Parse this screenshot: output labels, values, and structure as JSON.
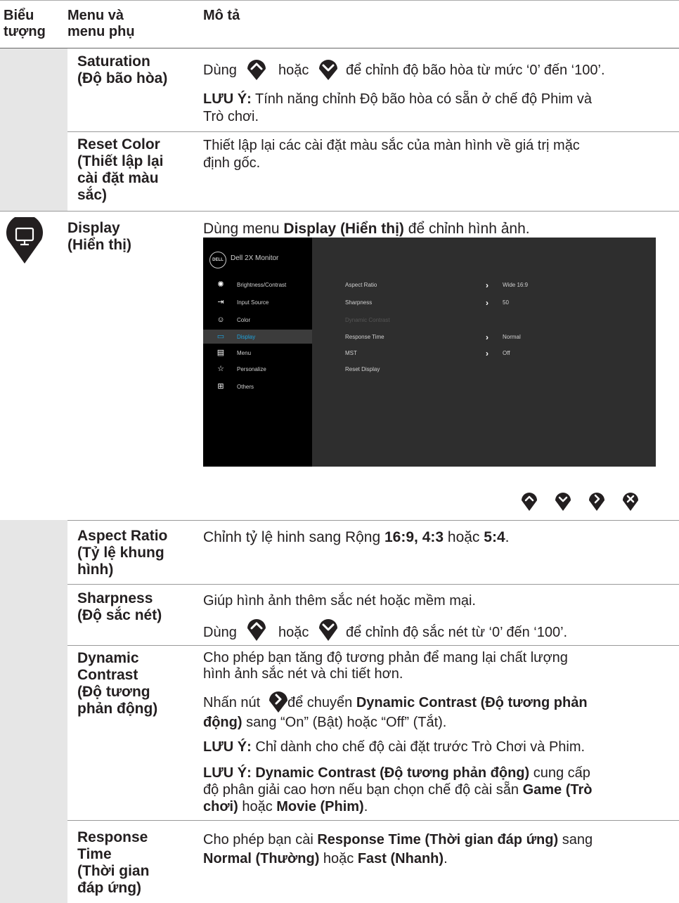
{
  "header": {
    "col1": [
      "Biểu",
      "tượng"
    ],
    "col2": [
      "Menu và",
      "menu phụ"
    ],
    "col3": "Mô tả"
  },
  "rows": {
    "saturation": {
      "label": [
        "Saturation",
        "(Độ bão hòa)"
      ],
      "line1_pre": "Dùng",
      "line1_mid": "hoặc",
      "line1_post": "để chỉnh độ bão hòa từ mức ‘0’ đến ‘100’.",
      "note_bold": "LƯU Ý:",
      "note_text": " Tính năng chỉnh Độ bão hòa có sẵn ở chế độ Phim và",
      "note_text2": "Trò chơi."
    },
    "reset_color": {
      "label": [
        "Reset Color",
        "(Thiết lập lại",
        "cài đặt màu",
        "sắc)"
      ],
      "desc": [
        "Thiết lập lại các cài đặt màu sắc của màn hình về giá trị mặc",
        "định gốc."
      ]
    },
    "display": {
      "label": [
        "Display",
        "(Hiển thị)"
      ],
      "desc_pre": "Dùng menu ",
      "desc_bold": "Display (Hiển thị)",
      "desc_post": " để chỉnh hình ảnh."
    },
    "aspect_ratio": {
      "label": [
        "Aspect Ratio",
        "(Tỷ lệ khung",
        "hình)"
      ],
      "desc_pre": "Chỉnh tỷ lệ hinh sang Rộng ",
      "desc_b1": "16:9, 4:3",
      "desc_mid": " hoặc ",
      "desc_b2": "5:4",
      "desc_post": "."
    },
    "sharpness": {
      "label": [
        "Sharpness",
        "(Độ sắc nét)"
      ],
      "desc1": "Giúp hình ảnh thêm sắc nét hoặc mềm mại.",
      "line2_pre": "Dùng",
      "line2_mid": "hoặc",
      "line2_post": "để chỉnh độ sắc nét từ ‘0’ đến ‘100’."
    },
    "dynamic_contrast": {
      "label": [
        "Dynamic",
        "Contrast",
        "(Độ tương",
        "phản động)"
      ],
      "desc1": [
        "Cho phép bạn tăng độ tương phản để mang lại chất lượng",
        "hình ảnh sắc nét và chi tiết hơn."
      ],
      "p2_pre": "Nhấn nút",
      "p2_mid": " để chuyển ",
      "p2_bold1": "Dynamic Contrast (Độ tương phản",
      "p2_bold2": "động)",
      "p2_post": " sang “On” (Bật) hoặc “Off” (Tắt).",
      "note1_bold": "LƯU Ý:",
      "note1_text": " Chỉ dành cho chế độ cài đặt trước Trò Chơi và Phim.",
      "note2_bold": "LƯU Ý: Dynamic Contrast (Độ tương phản động)",
      "note2_text": " cung cấp",
      "note2_line2_pre": "độ phân giải cao hơn nếu bạn chọn chế độ cài sẵn ",
      "note2_line2_bold": "Game (Trò",
      "note2_line3_bold1": "chơi)",
      "note2_line3_mid": " hoặc ",
      "note2_line3_bold2": "Movie (Phim)",
      "note2_line3_post": "."
    },
    "response_time": {
      "label": [
        "Response",
        "Time",
        "(Thời gian",
        "đáp ứng)"
      ],
      "l1_pre": "Cho phép bạn cài ",
      "l1_bold": "Response Time (Thời gian đáp ứng)",
      "l1_post": " sang",
      "l2_bold1": "Normal (Thường)",
      "l2_mid": " hoặc ",
      "l2_bold2": "Fast (Nhanh)",
      "l2_post": "."
    }
  },
  "osd": {
    "logo": "DELL",
    "title": "Dell 2X Monitor",
    "menu": [
      {
        "label": "Brightness/Contrast",
        "icon": "brightness-icon"
      },
      {
        "label": "Input Source",
        "icon": "input-source-icon"
      },
      {
        "label": "Color",
        "icon": "color-icon"
      },
      {
        "label": "Display",
        "icon": "display-icon",
        "selected": true
      },
      {
        "label": "Menu",
        "icon": "menu-icon"
      },
      {
        "label": "Personalize",
        "icon": "star-icon"
      },
      {
        "label": "Others",
        "icon": "others-icon"
      }
    ],
    "settings": [
      {
        "label": "Aspect Ratio",
        "value": "Wide 16:9",
        "enabled": true
      },
      {
        "label": "Sharpness",
        "value": "50",
        "enabled": true
      },
      {
        "label": "Dynamic Contrast",
        "value": "",
        "enabled": false
      },
      {
        "label": "Response Time",
        "value": "Normal",
        "enabled": true
      },
      {
        "label": "MST",
        "value": "Off",
        "enabled": true
      },
      {
        "label": "Reset Display",
        "value": "",
        "enabled": true
      }
    ],
    "accent": "#1fa3dd"
  },
  "buttons": [
    "up-button",
    "down-button",
    "right-button",
    "exit-button"
  ]
}
